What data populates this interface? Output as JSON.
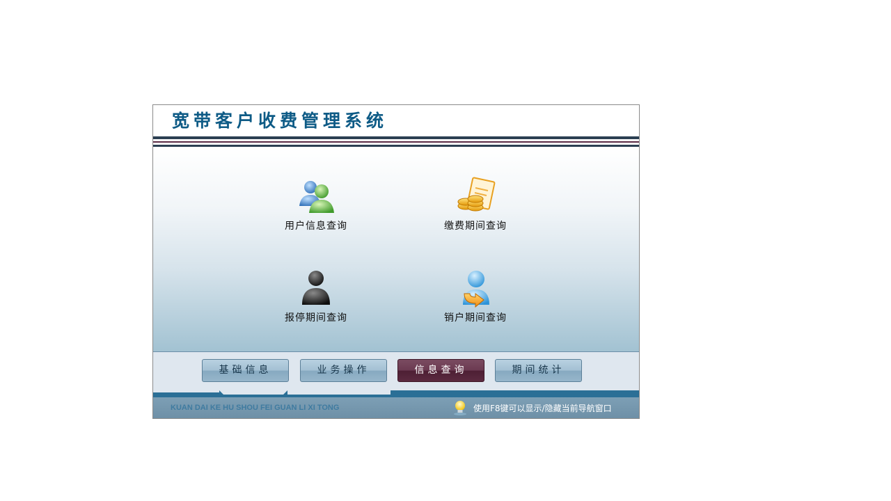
{
  "app": {
    "title": "宽带客户收费管理系统"
  },
  "tiles": [
    {
      "label": "用户信息查询",
      "icon": "users-icon"
    },
    {
      "label": "缴费期间查询",
      "icon": "payment-icon"
    },
    {
      "label": "报停期间查询",
      "icon": "suspend-user-icon"
    },
    {
      "label": "销户期间查询",
      "icon": "cancel-account-icon"
    }
  ],
  "nav": [
    {
      "label": "基础信息",
      "active": false
    },
    {
      "label": "业务操作",
      "active": false
    },
    {
      "label": "信息查询",
      "active": true
    },
    {
      "label": "期间统计",
      "active": false
    }
  ],
  "footer": {
    "pinyin": "KUAN DAI KE HU SHOU FEI GUAN LI XI TONG",
    "tip": "使用F8键可以显示/隐藏当前导航窗口"
  },
  "colors": {
    "title": "#0e5b86",
    "active_nav": "#5b2a40",
    "nav": "#a3c0d3",
    "footer": "#6e90a7"
  }
}
